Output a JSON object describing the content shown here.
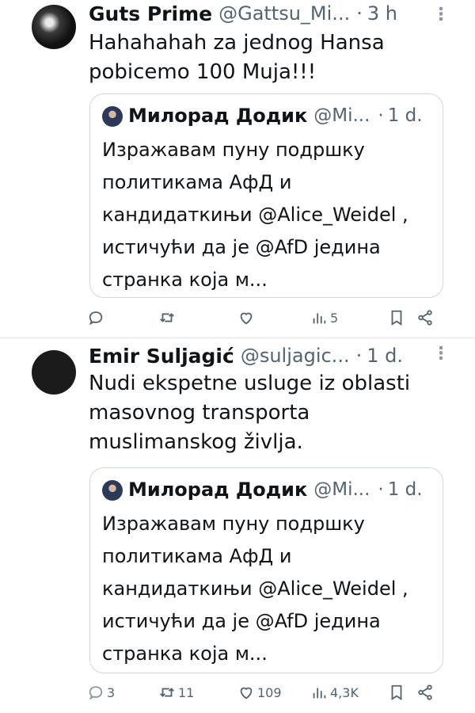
{
  "feed": {
    "posts": [
      {
        "author_name": "Guts Prime",
        "author_handle": "@Gattsu_Mi...",
        "separator": "·",
        "time": "3 h",
        "text": "Hahahahah za jednog Hansa pobicemo 100 Muja!!!",
        "quote": {
          "author_name": "Милорад Додик",
          "author_handle": "@Mi...",
          "separator": "·",
          "time": "1 d.",
          "text": "Изражавам пуну подршку политикама АфД и кандидаткињи @Alice_Weidel , истичући да је @AfD једина странка која м..."
        },
        "actions": {
          "replies": "",
          "retweets": "",
          "likes": "",
          "views": "5"
        }
      },
      {
        "author_name": "Emir Suljagić",
        "author_handle": "@suljagic...",
        "separator": "·",
        "time": "1 d.",
        "text": "Nudi ekspetne usluge iz oblasti masovnog transporta muslimanskog življa.",
        "quote": {
          "author_name": "Милорад Додик",
          "author_handle": "@Mi...",
          "separator": "·",
          "time": "1 d.",
          "text": "Изражавам пуну подршку политикама АфД и кандидаткињи @Alice_Weidel , истичући да је @AfD једина странка која м..."
        },
        "actions": {
          "replies": "3",
          "retweets": "11",
          "likes": "109",
          "views": "4,3K"
        }
      }
    ]
  },
  "icons": {
    "more": "more-options-icon",
    "reply": "reply-icon",
    "retweet": "retweet-icon",
    "like": "heart-icon",
    "views": "views-chart-icon",
    "bookmark": "bookmark-icon",
    "share": "share-icon"
  },
  "colors": {
    "text_primary": "#0f1419",
    "text_secondary": "#536471",
    "border": "#cfd9de",
    "divider": "#eff3f4"
  }
}
